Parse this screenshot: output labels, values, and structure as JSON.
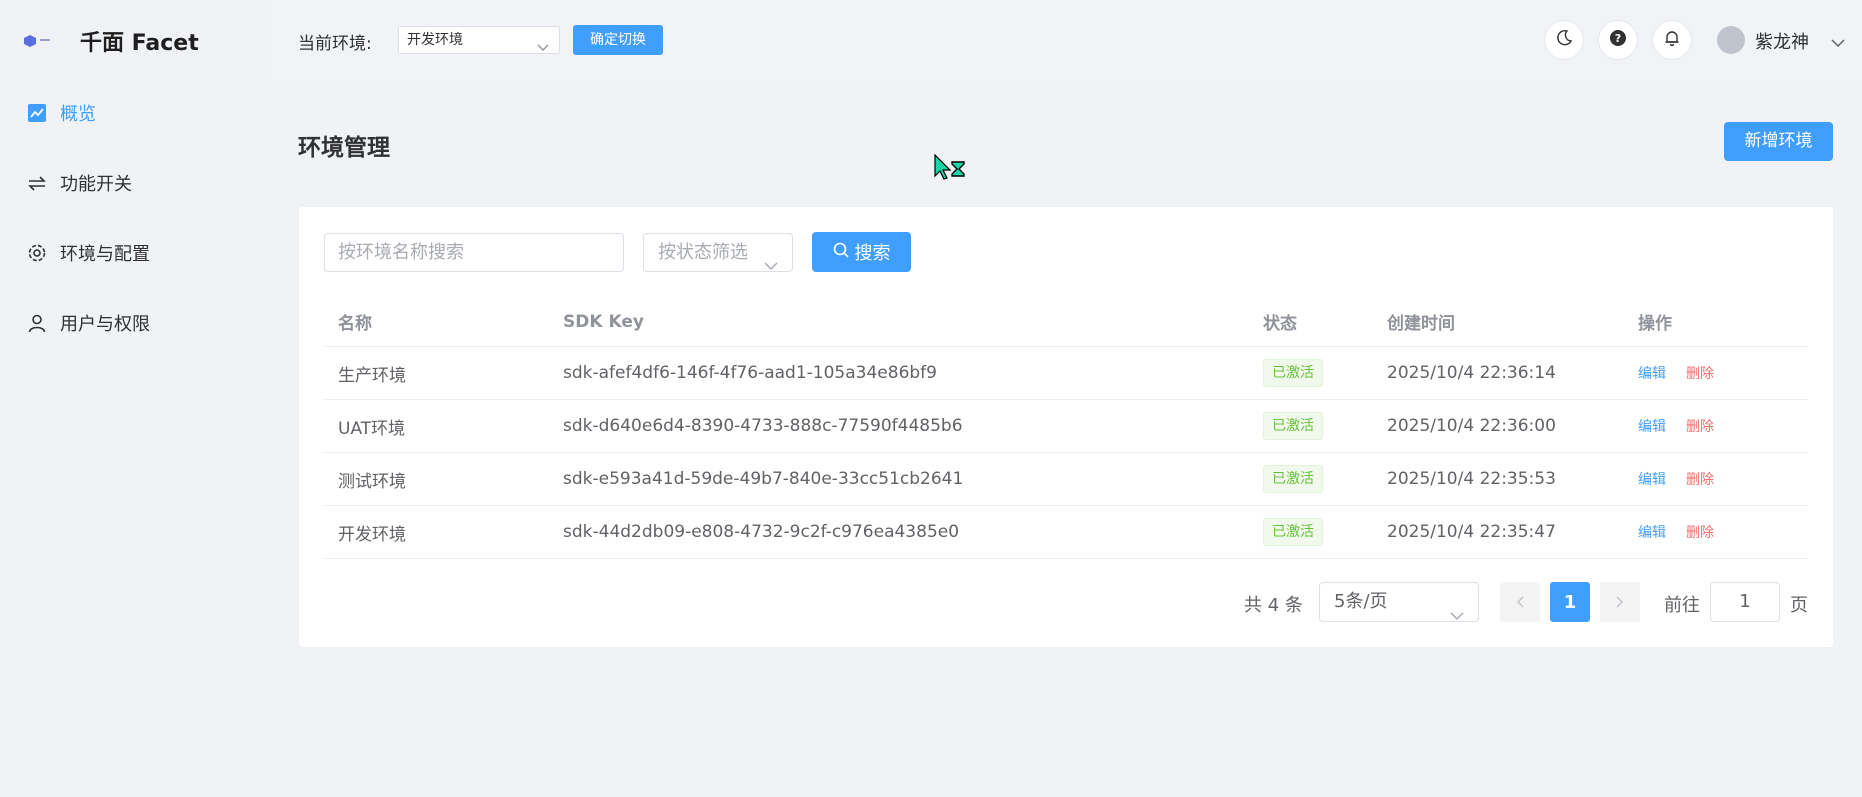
{
  "app": {
    "title": "千面 Facet"
  },
  "sidebar": {
    "items": [
      {
        "label": "概览",
        "icon": "chart-line-icon",
        "active": true
      },
      {
        "label": "功能开关",
        "icon": "toggle-arrows-icon",
        "active": false
      },
      {
        "label": "环境与配置",
        "icon": "gear-icon",
        "active": false
      },
      {
        "label": "用户与权限",
        "icon": "user-icon",
        "active": false
      }
    ]
  },
  "header": {
    "env_label": "当前环境:",
    "env_value": "开发环境",
    "switch_label": "确定切换",
    "user_name": "紫龙神"
  },
  "page": {
    "title": "环境管理",
    "add_label": "新增环境"
  },
  "filters": {
    "search_placeholder": "按环境名称搜索",
    "status_placeholder": "按状态筛选",
    "search_label": "搜索"
  },
  "table": {
    "columns": [
      "名称",
      "SDK Key",
      "状态",
      "创建时间",
      "操作"
    ],
    "rows": [
      {
        "name": "生产环境",
        "sdk_key": "sdk-afef4df6-146f-4f76-aad1-105a34e86bf9",
        "status": "已激活",
        "created": "2025/10/4 22:36:14",
        "edit": "编辑",
        "delete": "删除"
      },
      {
        "name": "UAT环境",
        "sdk_key": "sdk-d640e6d4-8390-4733-888c-77590f4485b6",
        "status": "已激活",
        "created": "2025/10/4 22:36:00",
        "edit": "编辑",
        "delete": "删除"
      },
      {
        "name": "测试环境",
        "sdk_key": "sdk-e593a41d-59de-49b7-840e-33cc51cb2641",
        "status": "已激活",
        "created": "2025/10/4 22:35:53",
        "edit": "编辑",
        "delete": "删除"
      },
      {
        "name": "开发环境",
        "sdk_key": "sdk-44d2db09-e808-4732-9c2f-c976ea4385e0",
        "status": "已激活",
        "created": "2025/10/4 22:35:47",
        "edit": "编辑",
        "delete": "删除"
      }
    ]
  },
  "pagination": {
    "total": "共 4 条",
    "page_size": "5条/页",
    "current": "1",
    "goto_label": "前往",
    "goto_value": "1",
    "goto_suffix": "页"
  },
  "colors": {
    "primary": "#409eff",
    "danger": "#f56c6c",
    "success": "#67c23a",
    "background": "#f0f2f5"
  }
}
